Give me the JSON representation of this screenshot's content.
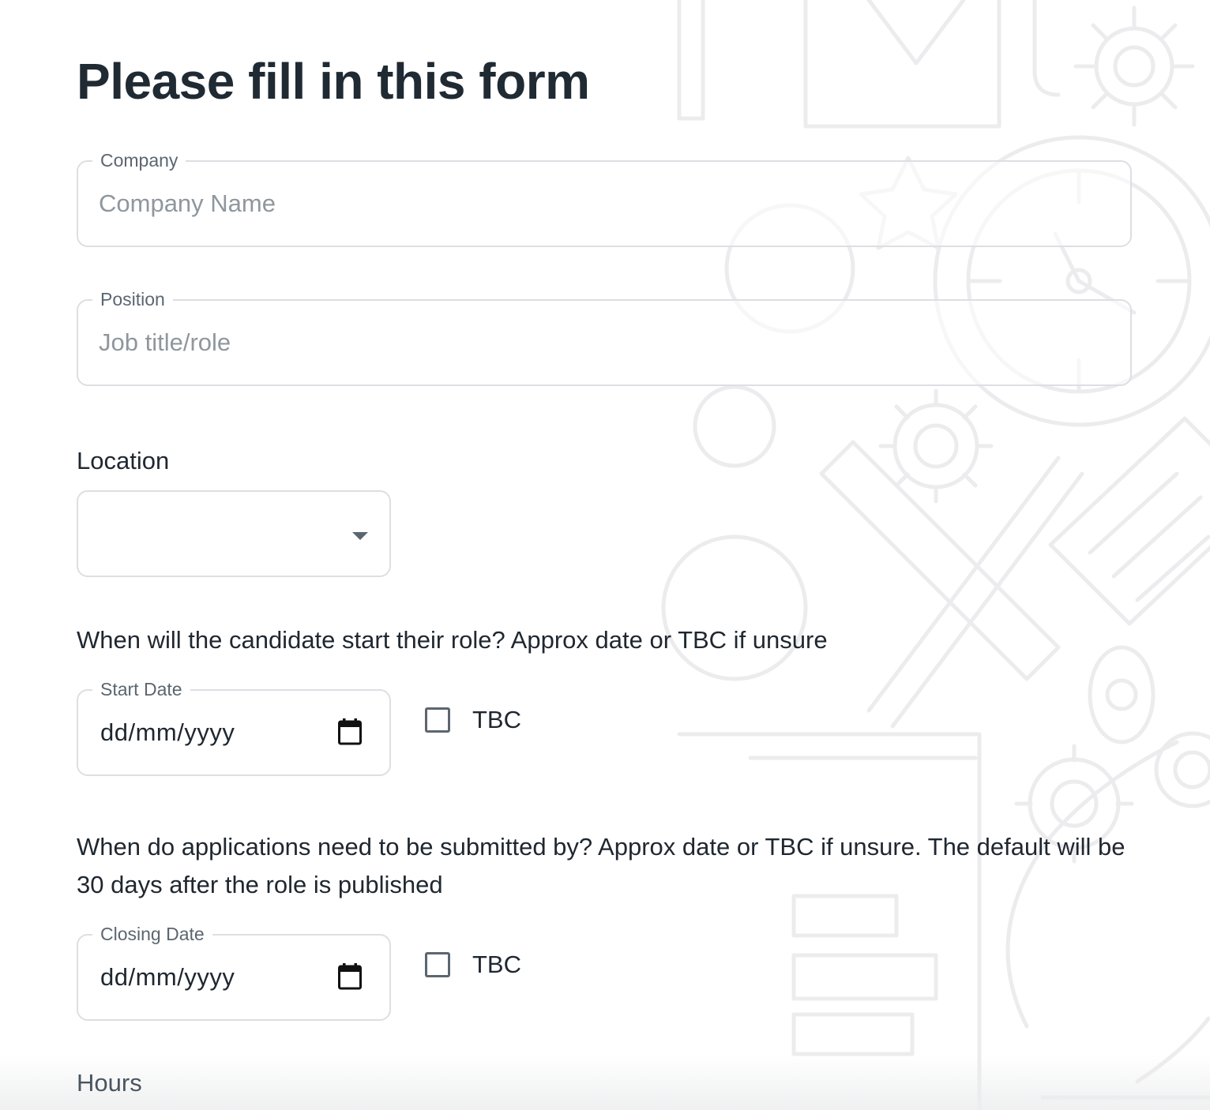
{
  "page": {
    "title": "Please fill in this form"
  },
  "company": {
    "legend": "Company",
    "placeholder": "Company Name",
    "value": ""
  },
  "position": {
    "legend": "Position",
    "placeholder": "Job title/role",
    "value": ""
  },
  "location": {
    "label": "Location",
    "selected": ""
  },
  "start": {
    "question": "When will the candidate start their role? Approx date or TBC if unsure",
    "legend": "Start Date",
    "date_value": "dd/mm/yyyy",
    "tbc_label": "TBC",
    "tbc_checked": false
  },
  "closing": {
    "question": "When do applications need to be submitted by? Approx date or TBC if unsure. The default will be 30 days after the role is published",
    "legend": "Closing Date",
    "date_value": "dd/mm/yyyy",
    "tbc_label": "TBC",
    "tbc_checked": false
  },
  "hours": {
    "label": "Hours"
  },
  "colors": {
    "text": "#1f2730",
    "border": "#dcdfe3",
    "muted": "#5c6670",
    "placeholder": "#8f979e"
  },
  "icons": {
    "select_arrow": "chevron-down-icon",
    "calendar": "calendar-icon",
    "background": "background-illustration"
  }
}
